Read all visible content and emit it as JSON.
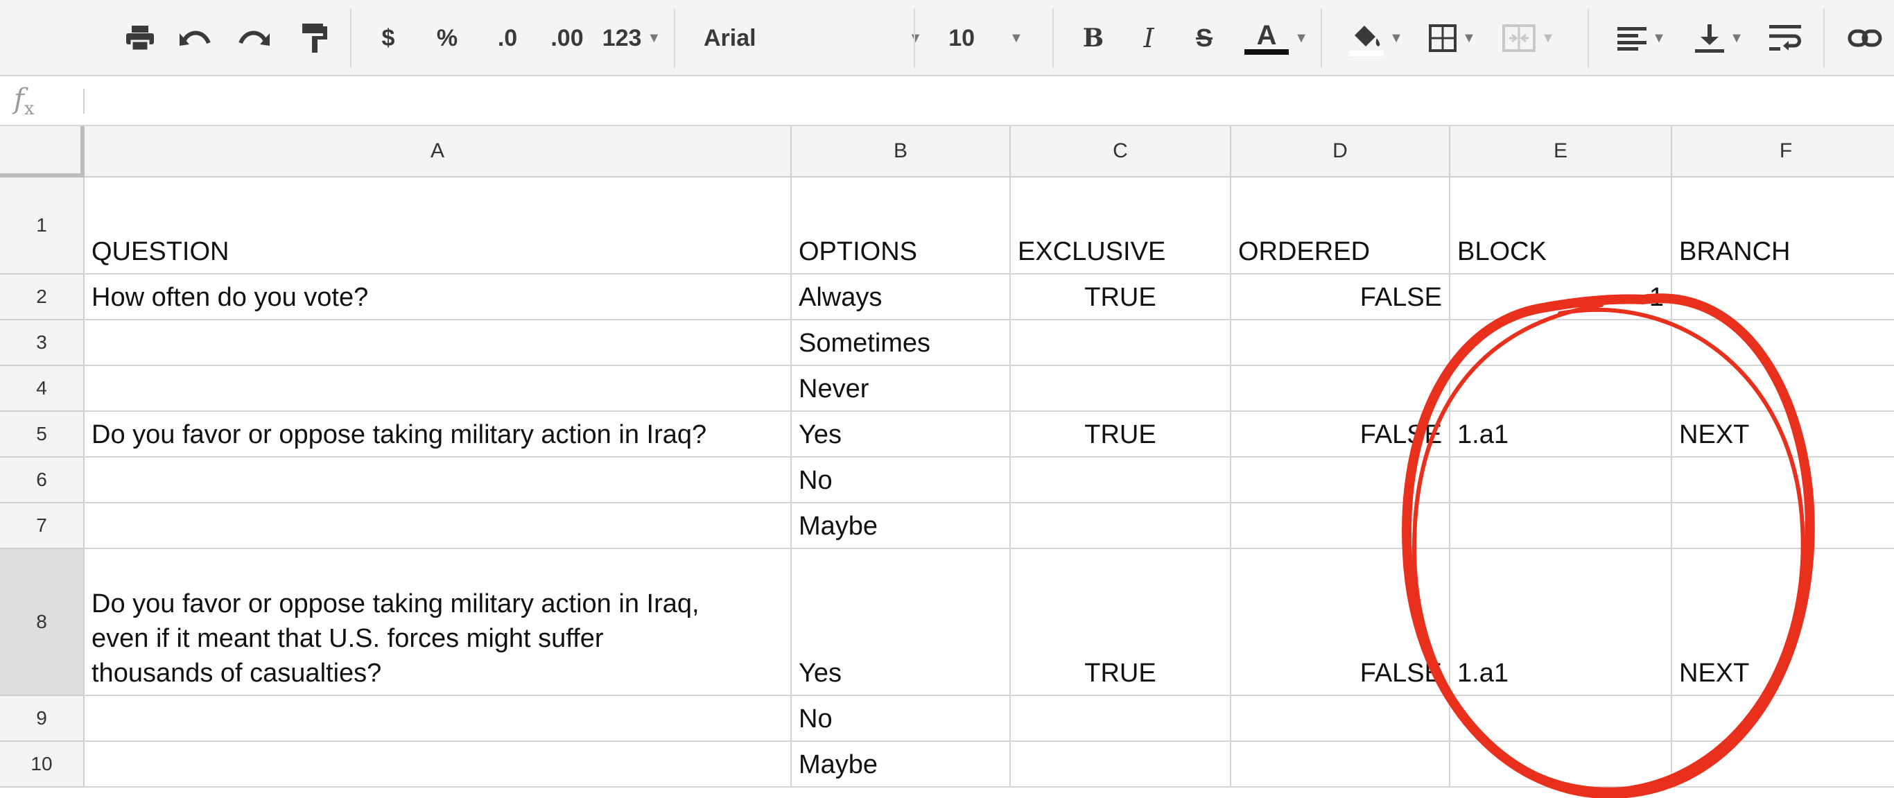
{
  "toolbar": {
    "currency": "$",
    "percent": "%",
    "dec_decrease": ".0",
    "dec_increase": ".00",
    "more_formats": "123",
    "font": "Arial",
    "font_size": "10",
    "bold": "B",
    "italic": "I",
    "strike": "S",
    "text_color": "A"
  },
  "formula_bar": {
    "label": "fx",
    "value": ""
  },
  "columns": [
    "A",
    "B",
    "C",
    "D",
    "E",
    "F"
  ],
  "rows": [
    {
      "num": "1",
      "cells": [
        "QUESTION",
        "OPTIONS",
        "EXCLUSIVE",
        "ORDERED",
        "BLOCK",
        "BRANCH"
      ]
    },
    {
      "num": "2",
      "cells": [
        "How often do you vote?",
        "Always",
        "TRUE",
        "FALSE",
        "1",
        ""
      ]
    },
    {
      "num": "3",
      "cells": [
        "",
        "Sometimes",
        "",
        "",
        "",
        ""
      ]
    },
    {
      "num": "4",
      "cells": [
        "",
        "Never",
        "",
        "",
        "",
        ""
      ]
    },
    {
      "num": "5",
      "cells": [
        "Do you favor or oppose taking military action in Iraq?",
        "Yes",
        "TRUE",
        "FALSE",
        "1.a1",
        "NEXT"
      ]
    },
    {
      "num": "6",
      "cells": [
        "",
        "No",
        "",
        "",
        "",
        ""
      ]
    },
    {
      "num": "7",
      "cells": [
        "",
        "Maybe",
        "",
        "",
        "",
        ""
      ]
    },
    {
      "num": "8",
      "cells": [
        "Do you favor or oppose taking military action in Iraq,\neven if it meant that U.S. forces might suffer\nthousands of casualties?",
        "Yes",
        "TRUE",
        "FALSE",
        "1.a1",
        "NEXT"
      ]
    },
    {
      "num": "9",
      "cells": [
        "",
        "No",
        "",
        "",
        "",
        ""
      ]
    },
    {
      "num": "10",
      "cells": [
        "",
        "Maybe",
        "",
        "",
        "",
        ""
      ]
    }
  ],
  "annotation_color": "#e8301c"
}
